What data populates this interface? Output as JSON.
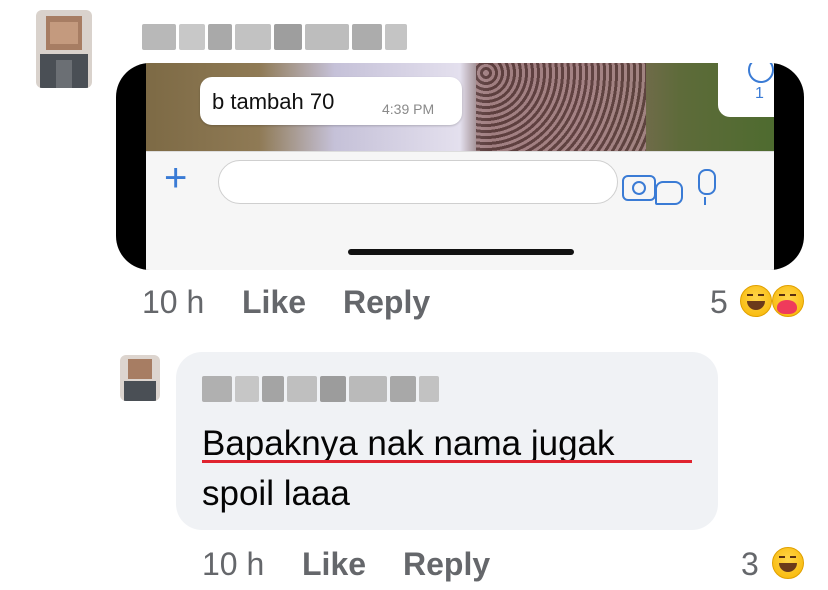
{
  "top_comment": {
    "screenshot": {
      "message_text": "b tambah 70",
      "message_time": "4:39 PM",
      "reply_count": "1"
    },
    "time": "10 h",
    "like_label": "Like",
    "reply_label": "Reply",
    "reaction_count": "5",
    "reactions": [
      "haha-emoji",
      "care-emoji"
    ]
  },
  "reply_comment": {
    "text_line1": "Bapaknya nak nama jugak",
    "text_line2": "spoil laaa",
    "time": "10 h",
    "like_label": "Like",
    "reply_label": "Reply",
    "reaction_count": "3",
    "reactions": [
      "haha-emoji"
    ]
  },
  "colors": {
    "meta_text": "#65676b",
    "bubble_bg": "#f0f2f5",
    "spellcheck_underline": "#e0242f",
    "whatsapp_blue": "#3a7bd5"
  }
}
